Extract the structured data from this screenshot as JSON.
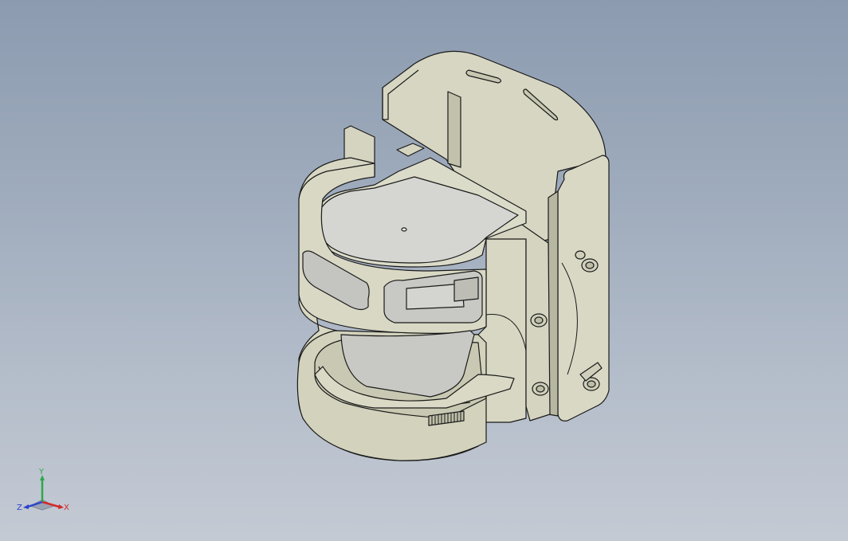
{
  "viewport": {
    "background_top": "#8c9bb0",
    "background_bottom": "#c4cad4"
  },
  "model": {
    "part_fill": "#dcdcc8",
    "part_shade": "#bdbda6",
    "part_dark": "#a9a993",
    "edge_color": "#1a1a1a",
    "lens_fill": "#d2d2cc"
  },
  "triad": {
    "x_label": "X",
    "y_label": "Y",
    "z_label": "Z",
    "x_color": "#d42a2a",
    "y_color": "#2ea84a",
    "z_color": "#2b46c9"
  }
}
